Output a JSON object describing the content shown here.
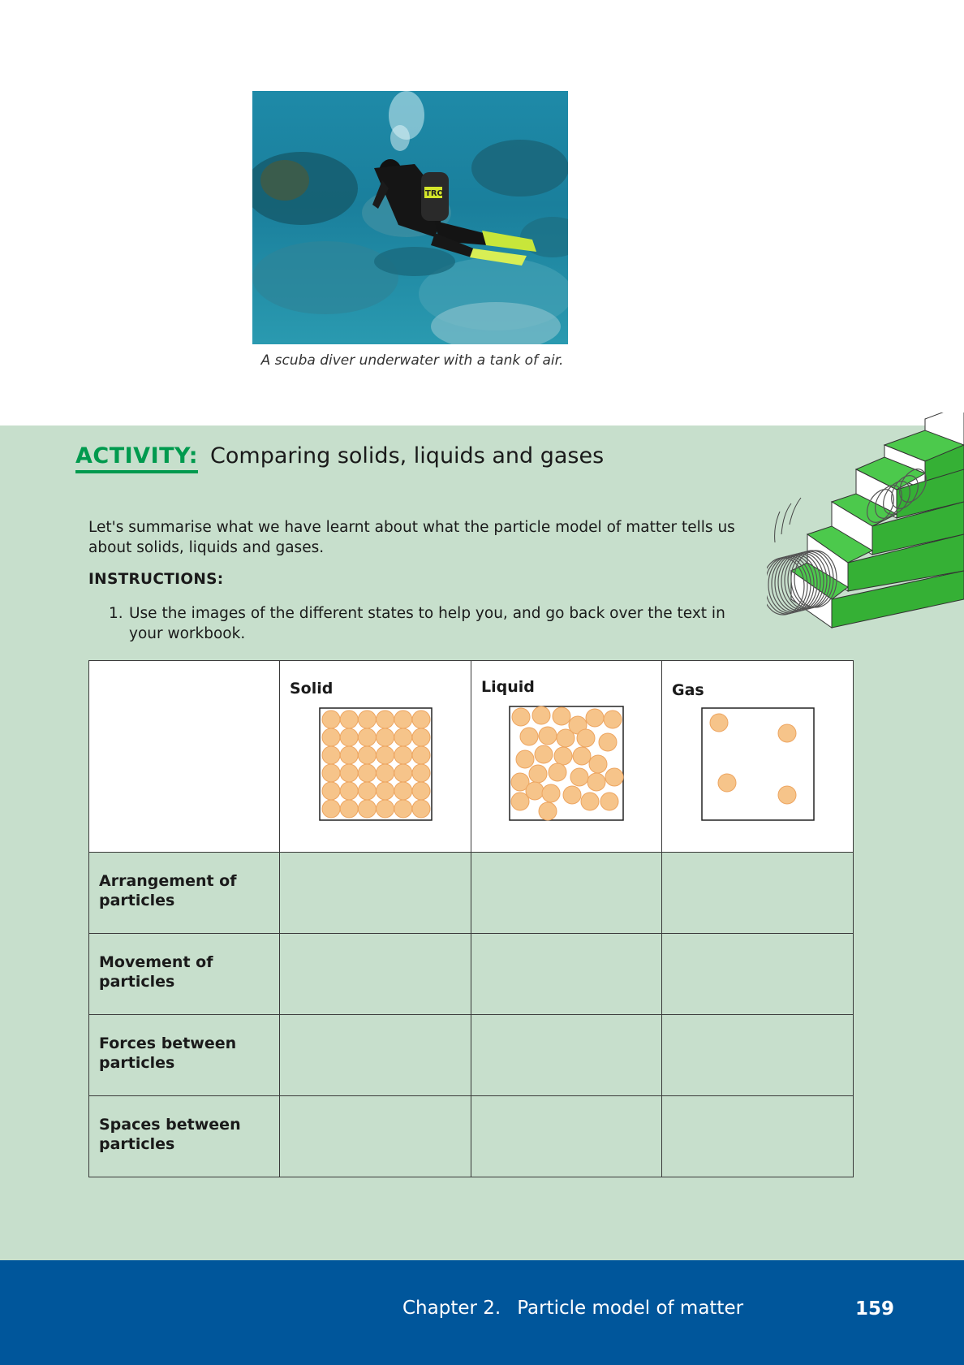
{
  "photo": {
    "caption": "A scuba diver underwater with a tank of air.",
    "tank_text": "TRO"
  },
  "activity": {
    "label": "ACTIVITY:",
    "title": "Comparing solids, liquids and gases",
    "intro": "Let's summarise what we have learnt about what the particle model of matter tells us about solids, liquids and gases.",
    "instructions_heading": "INSTRUCTIONS:",
    "instructions": [
      {
        "number": "1.",
        "text": "Use the images of the different states to help you, and go back over the text in your workbook."
      }
    ]
  },
  "table": {
    "columns": [
      "Solid",
      "Liquid",
      "Gas"
    ],
    "rows": [
      "Arrangement of particles",
      "Movement of particles",
      "Forces between particles",
      "Spaces between particles"
    ]
  },
  "colors": {
    "activity_background": "#c7dfcc",
    "activity_accent": "#009a4e",
    "footer_background": "#00569b",
    "particle_fill": "#f6c48a",
    "particle_stroke": "#eda560"
  },
  "footer": {
    "chapter": "Chapter 2.",
    "chapter_title": "Particle model of matter",
    "page_number": "159"
  }
}
